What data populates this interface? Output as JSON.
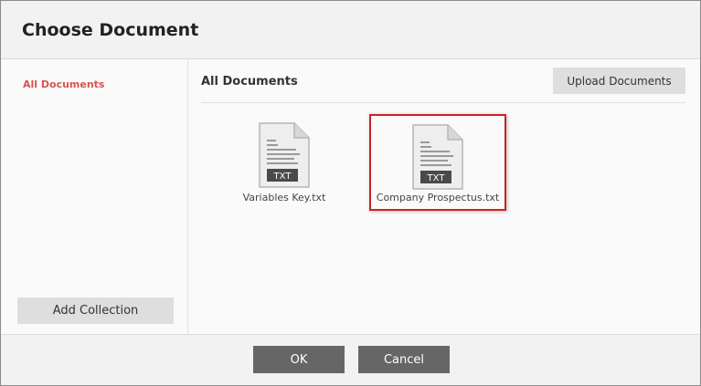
{
  "dialog": {
    "title": "Choose Document"
  },
  "sidebar": {
    "items": [
      {
        "label": "All Documents",
        "active": true
      }
    ],
    "add_collection_label": "Add Collection"
  },
  "main": {
    "title": "All Documents",
    "upload_label": "Upload Documents",
    "documents": [
      {
        "name": "Variables Key.txt",
        "type_badge": "TXT",
        "icon": "txt-file-icon",
        "selected": false
      },
      {
        "name": "Company Prospectus.txt",
        "type_badge": "TXT",
        "icon": "txt-file-icon",
        "selected": true
      }
    ]
  },
  "footer": {
    "ok_label": "OK",
    "cancel_label": "Cancel"
  },
  "colors": {
    "accent": "#d9534f",
    "selection_border": "#cc2222",
    "primary_button": "#666666",
    "secondary_button": "#dedede"
  }
}
